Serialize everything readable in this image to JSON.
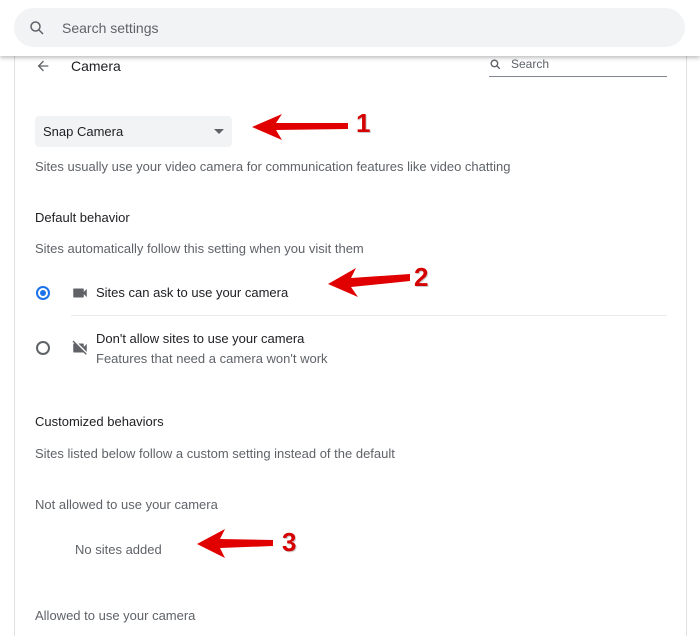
{
  "topbar": {
    "search_placeholder": "Search settings",
    "search_icon": "search-icon"
  },
  "header": {
    "back_icon": "arrow-back-icon",
    "title": "Camera",
    "search_placeholder": "Search",
    "search_icon": "search-icon"
  },
  "camera_select": {
    "selected": "Snap Camera",
    "icon": "caret-down-icon"
  },
  "description": "Sites usually use your video camera for communication features like video chatting",
  "default_behavior": {
    "heading": "Default behavior",
    "subtext": "Sites automatically follow this setting when you visit them",
    "options": [
      {
        "label": "Sites can ask to use your camera",
        "sublabel": "",
        "checked": true,
        "icon": "videocam-icon"
      },
      {
        "label": "Don't allow sites to use your camera",
        "sublabel": "Features that need a camera won't work",
        "checked": false,
        "icon": "videocam-off-icon"
      }
    ]
  },
  "customized_behaviors": {
    "heading": "Customized behaviors",
    "subtext": "Sites listed below follow a custom setting instead of the default",
    "not_allowed": {
      "heading": "Not allowed to use your camera",
      "empty": "No sites added"
    },
    "allowed": {
      "heading": "Allowed to use your camera"
    }
  },
  "annotations": {
    "color": "#e00000",
    "labels": [
      "1",
      "2",
      "3"
    ]
  },
  "colors": {
    "accent": "#1a73e8",
    "annotation_red": "#e00000"
  }
}
